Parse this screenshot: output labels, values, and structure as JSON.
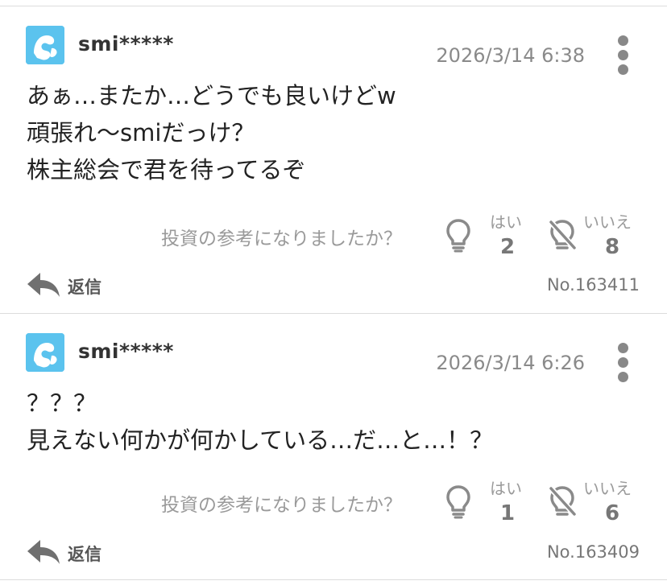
{
  "comments": [
    {
      "username": "smi*****",
      "timestamp": "2026/3/14 6:38",
      "lines": [
        "あぁ…またか…どうでも良いけどw",
        "頑張れ〜smiだっけ？",
        "株主総会で君を待ってるぞ"
      ],
      "question": "投資の参考になりましたか？",
      "yes_label": "はい",
      "yes_count": "2",
      "no_label": "いいえ",
      "no_count": "8",
      "reply_label": "返信",
      "number": "No.163411"
    },
    {
      "username": "smi*****",
      "timestamp": "2026/3/14 6:26",
      "lines": [
        "？？？",
        "見えない何かが何かしている…だ…と…！？"
      ],
      "question": "投資の参考になりましたか？",
      "yes_label": "はい",
      "yes_count": "1",
      "no_label": "いいえ",
      "no_count": "6",
      "reply_label": "返信",
      "number": "No.163409"
    }
  ],
  "icons": {
    "avatar": "default-avatar-icon",
    "more": "more-vertical-icon",
    "yes": "lightbulb-icon",
    "no": "lightbulb-off-icon",
    "reply": "reply-arrow-icon"
  },
  "colors": {
    "avatar_bg": "#5bc3ee",
    "text": "#222222",
    "muted": "#9a9a9a"
  }
}
